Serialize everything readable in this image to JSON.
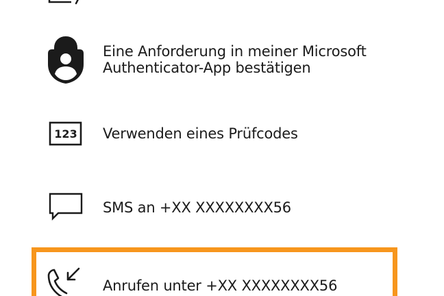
{
  "options": [
    {
      "icon": "authenticator-lock-icon",
      "label_line1": "Eine Anforderung in meiner Microsoft",
      "label_line2": "Authenticator-App bestätigen"
    },
    {
      "icon": "verification-code-icon",
      "icon_text": "123",
      "label": "Verwenden eines Prüfcodes"
    },
    {
      "icon": "sms-bubble-icon",
      "label": "SMS an +XX XXXXXXXX56"
    },
    {
      "icon": "incoming-call-icon",
      "label": "Anrufen unter +XX XXXXXXXX56",
      "selected": true
    }
  ],
  "colors": {
    "selection_border": "#f7961d",
    "text": "#1b1b1b",
    "icon": "#1b1b1b",
    "background": "#ffffff"
  }
}
